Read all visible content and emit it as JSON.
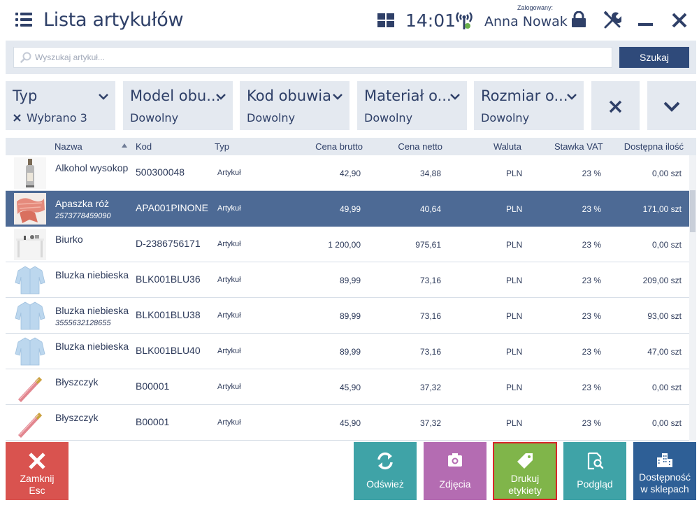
{
  "header": {
    "title": "Lista artykułów",
    "time": "14:01",
    "logged_label": "Zalogowany:",
    "user": "Anna Nowak"
  },
  "search": {
    "placeholder": "Wyszukaj artykuł...",
    "button": "Szukaj"
  },
  "filters": [
    {
      "label": "Typ",
      "value": "Wybrano 3",
      "clearable": true
    },
    {
      "label": "Model obu...",
      "value": "Dowolny"
    },
    {
      "label": "Kod obuwia",
      "value": "Dowolny"
    },
    {
      "label": "Materiał o...",
      "value": "Dowolny"
    },
    {
      "label": "Rozmiar o...",
      "value": "Dowolny"
    }
  ],
  "table": {
    "columns": [
      "Nazwa",
      "Kod",
      "Typ",
      "Cena brutto",
      "Cena netto",
      "Waluta",
      "Stawka VAT",
      "Dostępna ilość"
    ],
    "rows": [
      {
        "name": "Alkohol wysokop",
        "ean": "",
        "kod": "500300048",
        "typ": "Artykuł",
        "brutto": "42,90",
        "netto": "34,88",
        "waluta": "PLN",
        "vat": "23 %",
        "ilosc": "0,00 szt",
        "thumb": "bottle-icon"
      },
      {
        "name": "Apaszka róż",
        "ean": "2573778459090",
        "kod": "APA001PINONE",
        "typ": "Artykuł",
        "brutto": "49,99",
        "netto": "40,64",
        "waluta": "PLN",
        "vat": "23 %",
        "ilosc": "171,00 szt",
        "thumb": "scarf-icon",
        "selected": true
      },
      {
        "name": "Biurko",
        "ean": "",
        "kod": "D-2386756171",
        "typ": "Artykuł",
        "brutto": "1 200,00",
        "netto": "975,61",
        "waluta": "PLN",
        "vat": "23 %",
        "ilosc": "0,00 szt",
        "thumb": "desk-icon"
      },
      {
        "name": "Bluzka niebieska",
        "ean": "",
        "kod": "BLK001BLU36",
        "typ": "Artykuł",
        "brutto": "89,99",
        "netto": "73,16",
        "waluta": "PLN",
        "vat": "23 %",
        "ilosc": "209,00 szt",
        "thumb": "shirt-icon"
      },
      {
        "name": "Bluzka niebieska",
        "ean": "3555632128655",
        "kod": "BLK001BLU38",
        "typ": "Artykuł",
        "brutto": "89,99",
        "netto": "73,16",
        "waluta": "PLN",
        "vat": "23 %",
        "ilosc": "93,00 szt",
        "thumb": "shirt-icon"
      },
      {
        "name": "Bluzka niebieska",
        "ean": "",
        "kod": "BLK001BLU40",
        "typ": "Artykuł",
        "brutto": "89,99",
        "netto": "73,16",
        "waluta": "PLN",
        "vat": "23 %",
        "ilosc": "47,00 szt",
        "thumb": "shirt-icon"
      },
      {
        "name": "Błyszczyk",
        "ean": "",
        "kod": "B00001",
        "typ": "Artykuł",
        "brutto": "45,90",
        "netto": "37,32",
        "waluta": "PLN",
        "vat": "23 %",
        "ilosc": "0,00 szt",
        "thumb": "lipgloss-icon"
      },
      {
        "name": "Błyszczyk",
        "ean": "",
        "kod": "B00001",
        "typ": "Artykuł",
        "brutto": "45,90",
        "netto": "37,32",
        "waluta": "PLN",
        "vat": "23 %",
        "ilosc": "0,00 szt",
        "thumb": "lipgloss-icon"
      }
    ]
  },
  "buttons": {
    "close": {
      "line1": "Zamknij",
      "line2": "Esc",
      "color": "#d9534f"
    },
    "refresh": {
      "label": "Odśwież",
      "color": "#3fa3a7"
    },
    "photos": {
      "label": "Zdjęcia",
      "color": "#b46cb2"
    },
    "print_labels": {
      "line1": "Drukuj",
      "line2": "etykiety",
      "color": "#80b54a",
      "highlight": "#d9262c"
    },
    "preview": {
      "label": "Podgląd",
      "color": "#3fa3a7"
    },
    "availability": {
      "line1": "Dostępność",
      "line2": "w sklepach",
      "color": "#2e5f96"
    }
  },
  "colors": {
    "primary": "#2f4068",
    "panel": "#e4e9f0",
    "selected_row": "#4d6a95"
  }
}
